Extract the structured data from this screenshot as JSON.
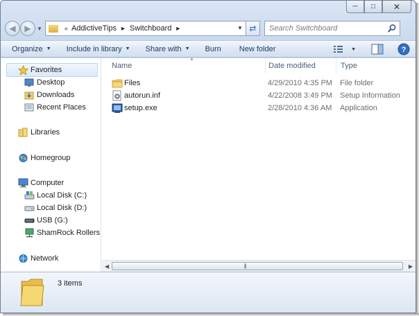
{
  "address": {
    "breadcrumb": [
      "AddictiveTips",
      "Switchboard"
    ],
    "search_placeholder": "Search Switchboard"
  },
  "toolbar": {
    "organize": "Organize",
    "include_in_library": "Include in library",
    "share_with": "Share with",
    "burn": "Burn",
    "new_folder": "New folder"
  },
  "nav_pane": {
    "favorites": "Favorites",
    "desktop": "Desktop",
    "downloads": "Downloads",
    "recent_places": "Recent Places",
    "libraries": "Libraries",
    "homegroup": "Homegroup",
    "computer": "Computer",
    "local_disk_c": "Local Disk (C:)",
    "local_disk_d": "Local Disk (D:)",
    "usb_g": "USB (G:)",
    "shamrock": "ShamRock Rollers",
    "network": "Network"
  },
  "columns": {
    "name": "Name",
    "date_modified": "Date modified",
    "type": "Type"
  },
  "files": [
    {
      "name": "Files",
      "date": "4/29/2010 4:35 PM",
      "type": "File folder",
      "icon": "folder-icon"
    },
    {
      "name": "autorun.inf",
      "date": "4/22/2008 3:49 PM",
      "type": "Setup Information",
      "icon": "settings-file-icon"
    },
    {
      "name": "setup.exe",
      "date": "2/28/2010 4:36 AM",
      "type": "Application",
      "icon": "application-icon"
    }
  ],
  "details": {
    "item_count": "3 items"
  }
}
